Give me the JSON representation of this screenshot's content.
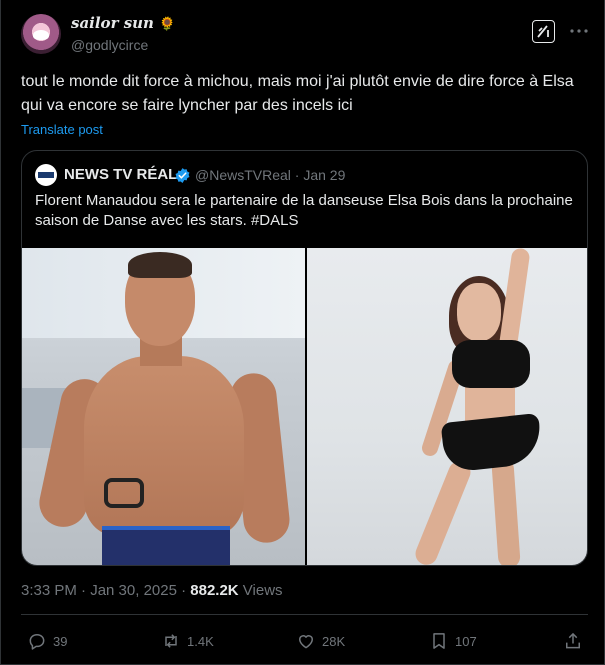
{
  "author": {
    "display_name": "sailor sun",
    "emoji": "🌻",
    "handle": "@godlycirce"
  },
  "tweet": {
    "text": "tout le monde dit force à michou, mais moi j'ai plutôt envie de dire force à Elsa qui va encore se faire lyncher par des incels ici",
    "translate_label": "Translate post"
  },
  "quote": {
    "author_name": "NEWS TV RÉAL",
    "author_handle": "@NewsTVReal · Jan 29",
    "text": "Florent Manaudou sera le partenaire de la danseuse Elsa Bois dans la prochaine saison de Danse avec les stars. #DALS"
  },
  "meta": {
    "timestamp": "3:33 PM · Jan 30, 2025 · ",
    "views_count": "882.2K",
    "views_label": " Views"
  },
  "actions": {
    "replies": "39",
    "reposts": "1.4K",
    "likes": "28K",
    "bookmarks": "107"
  },
  "colors": {
    "background": "#000000",
    "text": "#e7e9ea",
    "muted": "#71767b",
    "link": "#1d9bf0",
    "border": "#2f3336"
  }
}
